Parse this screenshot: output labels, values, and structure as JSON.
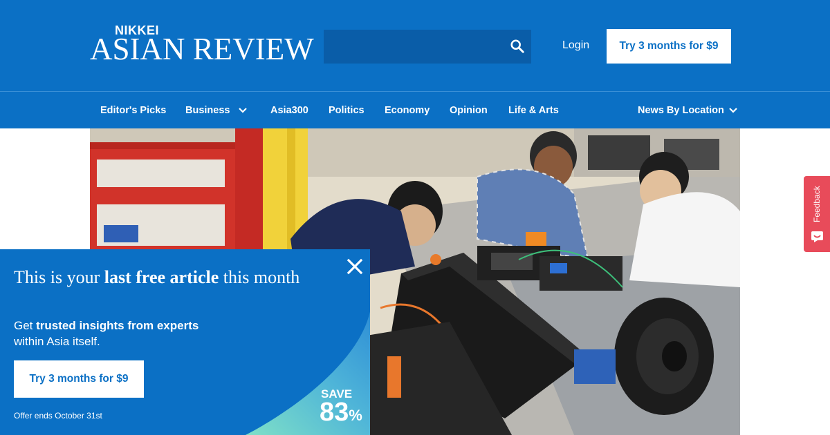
{
  "header": {
    "logo_top": "NIKKEI",
    "logo_main": "ASIAN REVIEW",
    "search_placeholder": "",
    "login_label": "Login",
    "subscribe_label": "Try 3 months for $9"
  },
  "nav": {
    "items": [
      {
        "label": "Editor's Picks"
      },
      {
        "label": "Business",
        "has_dropdown": true
      },
      {
        "label": "Asia300"
      },
      {
        "label": "Politics"
      },
      {
        "label": "Economy"
      },
      {
        "label": "Opinion"
      },
      {
        "label": "Life & Arts"
      },
      {
        "label": "News By Location",
        "has_dropdown": true
      }
    ]
  },
  "feedback": {
    "label": "Feedback"
  },
  "paywall": {
    "title_pre": "This is your ",
    "title_bold": "last free article",
    "title_post": " this month",
    "sub_pre": "Get ",
    "sub_bold": "trusted insights from experts",
    "sub_post": "within Asia itself.",
    "cta_label": "Try 3 months for $9",
    "offer_text": "Offer ends October 31st",
    "save_label": "SAVE",
    "save_value": "83",
    "save_unit": "%"
  },
  "colors": {
    "brand_blue": "#0b70c5",
    "search_bg": "#0a5da8",
    "feedback_red": "#e84b5a",
    "wave_teal": "#5fd3c0"
  },
  "icons": [
    "search-icon",
    "chevron-down-icon",
    "close-icon",
    "feedback-icon"
  ]
}
